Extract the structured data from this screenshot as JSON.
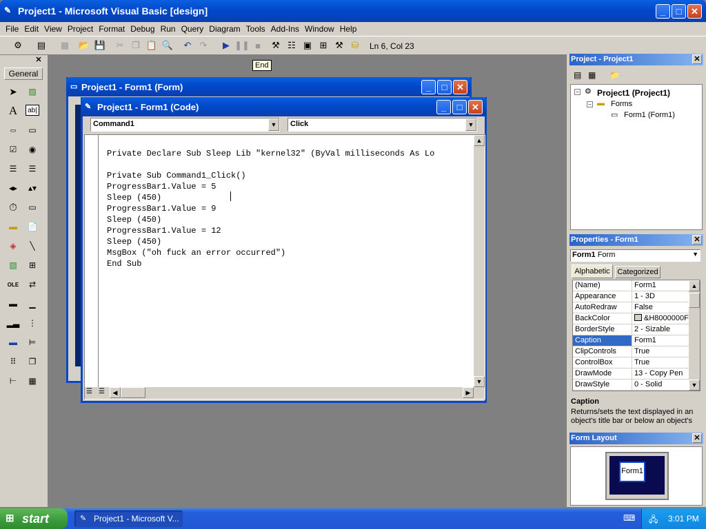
{
  "window": {
    "title": "Project1 - Microsoft Visual Basic [design]"
  },
  "menu": [
    "File",
    "Edit",
    "View",
    "Project",
    "Format",
    "Debug",
    "Run",
    "Query",
    "Diagram",
    "Tools",
    "Add-Ins",
    "Window",
    "Help"
  ],
  "toolbar": {
    "position": "Ln 6, Col 23",
    "tooltip": "End"
  },
  "toolbox": {
    "title": "General"
  },
  "form_window": {
    "title": "Project1 - Form1 (Form)"
  },
  "code_window": {
    "title": "Project1 - Form1 (Code)",
    "object_combo": "Command1",
    "proc_combo": "Click",
    "lines": [
      "Private Declare Sub Sleep Lib \"kernel32\" (ByVal milliseconds As Lo",
      "",
      "Private Sub Command1_Click()",
      "ProgressBar1.Value = 5",
      "Sleep (450)",
      "ProgressBar1.Value = 9",
      "Sleep (450)",
      "ProgressBar1.Value = 12",
      "Sleep (450)",
      "MsgBox (\"oh fuck an error occurred\")",
      "End Sub"
    ]
  },
  "project_panel": {
    "title": "Project - Project1",
    "root": "Project1 (Project1)",
    "folder": "Forms",
    "item": "Form1 (Form1)"
  },
  "properties_panel": {
    "title": "Properties - Form1",
    "object": "Form1",
    "object_type": "Form",
    "tabs": [
      "Alphabetic",
      "Categorized"
    ],
    "rows": [
      {
        "name": "(Name)",
        "value": "Form1"
      },
      {
        "name": "Appearance",
        "value": "1 - 3D"
      },
      {
        "name": "AutoRedraw",
        "value": "False"
      },
      {
        "name": "BackColor",
        "value": "&H8000000F"
      },
      {
        "name": "BorderStyle",
        "value": "2 - Sizable"
      },
      {
        "name": "Caption",
        "value": "Form1"
      },
      {
        "name": "ClipControls",
        "value": "True"
      },
      {
        "name": "ControlBox",
        "value": "True"
      },
      {
        "name": "DrawMode",
        "value": "13 - Copy Pen"
      },
      {
        "name": "DrawStyle",
        "value": "0 - Solid"
      }
    ],
    "desc_title": "Caption",
    "desc_text": "Returns/sets the text displayed in an object's title bar or below an object's"
  },
  "layout_panel": {
    "title": "Form Layout",
    "form_label": "Form1"
  },
  "taskbar": {
    "start": "start",
    "task": "Project1 - Microsoft V...",
    "clock": "3:01 PM"
  },
  "colors": {
    "accent": "#316ac5",
    "titlebar": "#0a5fe0",
    "taskbar": "#245edb"
  }
}
